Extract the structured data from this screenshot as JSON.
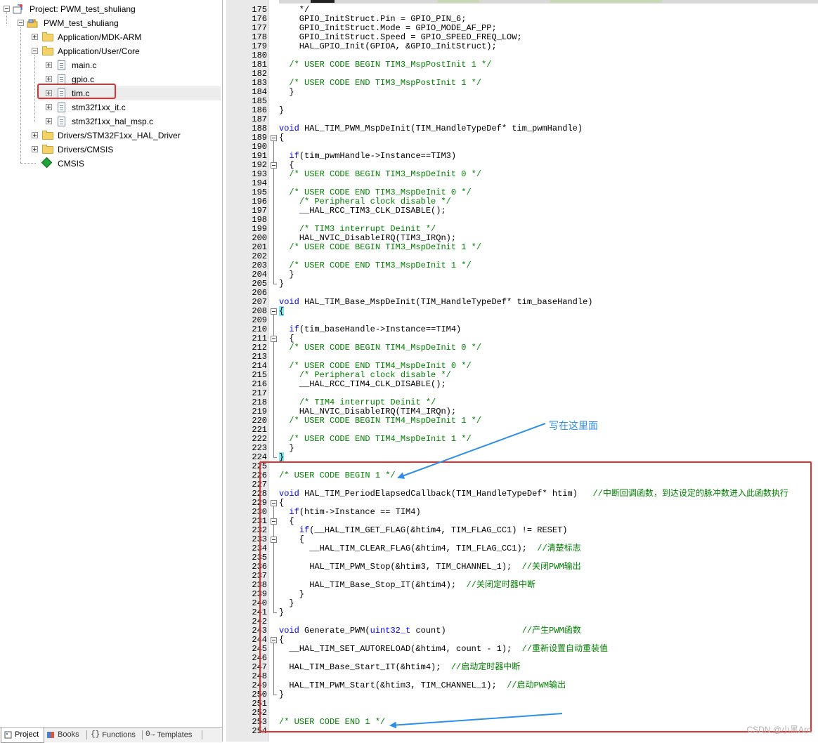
{
  "project_tree": {
    "root": "Project: PWM_test_shuliang",
    "target": "PWM_test_shuliang",
    "groups": [
      "Application/MDK-ARM",
      "Application/User/Core",
      "Drivers/STM32F1xx_HAL_Driver",
      "Drivers/CMSIS"
    ],
    "files": [
      "main.c",
      "gpio.c",
      "tim.c",
      "stm32f1xx_it.c",
      "stm32f1xx_hal_msp.c"
    ],
    "cmsis": "CMSIS",
    "selected_file": "tim.c"
  },
  "bottom_tabs": [
    "Project",
    "Books",
    "Functions",
    "Templates"
  ],
  "code_lines": [
    {
      "n": "175",
      "t": "    */"
    },
    {
      "n": "176",
      "t": "    GPIO_InitStruct.Pin = GPIO_PIN_6;"
    },
    {
      "n": "177",
      "t": "    GPIO_InitStruct.Mode = GPIO_MODE_AF_PP;"
    },
    {
      "n": "178",
      "t": "    GPIO_InitStruct.Speed = GPIO_SPEED_FREQ_LOW;"
    },
    {
      "n": "179",
      "t": "    HAL_GPIO_Init(GPIOA, &GPIO_InitStruct);"
    },
    {
      "n": "180",
      "t": ""
    },
    {
      "n": "181",
      "t": "  /* USER CODE BEGIN TIM3_MspPostInit 1 */"
    },
    {
      "n": "182",
      "t": ""
    },
    {
      "n": "183",
      "t": "  /* USER CODE END TIM3_MspPostInit 1 */"
    },
    {
      "n": "184",
      "t": "  }"
    },
    {
      "n": "185",
      "t": ""
    },
    {
      "n": "186",
      "t": "}"
    },
    {
      "n": "187",
      "t": ""
    },
    {
      "n": "188",
      "t": "void HAL_TIM_PWM_MspDeInit(TIM_HandleTypeDef* tim_pwmHandle)"
    },
    {
      "n": "189",
      "t": "{"
    },
    {
      "n": "190",
      "t": ""
    },
    {
      "n": "191",
      "t": "  if(tim_pwmHandle->Instance==TIM3)"
    },
    {
      "n": "192",
      "t": "  {"
    },
    {
      "n": "193",
      "t": "  /* USER CODE BEGIN TIM3_MspDeInit 0 */"
    },
    {
      "n": "194",
      "t": ""
    },
    {
      "n": "195",
      "t": "  /* USER CODE END TIM3_MspDeInit 0 */"
    },
    {
      "n": "196",
      "t": "    /* Peripheral clock disable */"
    },
    {
      "n": "197",
      "t": "    __HAL_RCC_TIM3_CLK_DISABLE();"
    },
    {
      "n": "198",
      "t": ""
    },
    {
      "n": "199",
      "t": "    /* TIM3 interrupt Deinit */"
    },
    {
      "n": "200",
      "t": "    HAL_NVIC_DisableIRQ(TIM3_IRQn);"
    },
    {
      "n": "201",
      "t": "  /* USER CODE BEGIN TIM3_MspDeInit 1 */"
    },
    {
      "n": "202",
      "t": ""
    },
    {
      "n": "203",
      "t": "  /* USER CODE END TIM3_MspDeInit 1 */"
    },
    {
      "n": "204",
      "t": "  }"
    },
    {
      "n": "205",
      "t": "}"
    },
    {
      "n": "206",
      "t": ""
    },
    {
      "n": "207",
      "t": "void HAL_TIM_Base_MspDeInit(TIM_HandleTypeDef* tim_baseHandle)"
    },
    {
      "n": "208",
      "t": "{"
    },
    {
      "n": "209",
      "t": ""
    },
    {
      "n": "210",
      "t": "  if(tim_baseHandle->Instance==TIM4)"
    },
    {
      "n": "211",
      "t": "  {"
    },
    {
      "n": "212",
      "t": "  /* USER CODE BEGIN TIM4_MspDeInit 0 */"
    },
    {
      "n": "213",
      "t": ""
    },
    {
      "n": "214",
      "t": "  /* USER CODE END TIM4_MspDeInit 0 */"
    },
    {
      "n": "215",
      "t": "    /* Peripheral clock disable */"
    },
    {
      "n": "216",
      "t": "    __HAL_RCC_TIM4_CLK_DISABLE();"
    },
    {
      "n": "217",
      "t": ""
    },
    {
      "n": "218",
      "t": "    /* TIM4 interrupt Deinit */"
    },
    {
      "n": "219",
      "t": "    HAL_NVIC_DisableIRQ(TIM4_IRQn);"
    },
    {
      "n": "220",
      "t": "  /* USER CODE BEGIN TIM4_MspDeInit 1 */"
    },
    {
      "n": "221",
      "t": ""
    },
    {
      "n": "222",
      "t": "  /* USER CODE END TIM4_MspDeInit 1 */"
    },
    {
      "n": "223",
      "t": "  }"
    },
    {
      "n": "224",
      "t": "}"
    },
    {
      "n": "225",
      "t": ""
    },
    {
      "n": "226",
      "t": "/* USER CODE BEGIN 1 */"
    },
    {
      "n": "227",
      "t": ""
    },
    {
      "n": "228",
      "t": "void HAL_TIM_PeriodElapsedCallback(TIM_HandleTypeDef* htim)   //中断回调函数，到达设定的脉冲数进入此函数执行"
    },
    {
      "n": "229",
      "t": "{"
    },
    {
      "n": "230",
      "t": "  if(htim->Instance == TIM4)"
    },
    {
      "n": "231",
      "t": "  {"
    },
    {
      "n": "232",
      "t": "    if(__HAL_TIM_GET_FLAG(&htim4, TIM_FLAG_CC1) != RESET)"
    },
    {
      "n": "233",
      "t": "    {"
    },
    {
      "n": "234",
      "t": "      __HAL_TIM_CLEAR_FLAG(&htim4, TIM_FLAG_CC1);  //清楚标志"
    },
    {
      "n": "235",
      "t": ""
    },
    {
      "n": "236",
      "t": "      HAL_TIM_PWM_Stop(&htim3, TIM_CHANNEL_1);  //关闭PWM输出"
    },
    {
      "n": "237",
      "t": ""
    },
    {
      "n": "238",
      "t": "      HAL_TIM_Base_Stop_IT(&htim4);  //关闭定时器中断"
    },
    {
      "n": "239",
      "t": "    }"
    },
    {
      "n": "240",
      "t": "  }"
    },
    {
      "n": "241",
      "t": "}"
    },
    {
      "n": "242",
      "t": ""
    },
    {
      "n": "243",
      "t": "void Generate_PWM(uint32_t count)               //产生PWM函数"
    },
    {
      "n": "244",
      "t": "{"
    },
    {
      "n": "245",
      "t": "  __HAL_TIM_SET_AUTORELOAD(&htim4, count - 1);  //重新设置自动重装值"
    },
    {
      "n": "246",
      "t": ""
    },
    {
      "n": "247",
      "t": "  HAL_TIM_Base_Start_IT(&htim4);  //启动定时器中断"
    },
    {
      "n": "248",
      "t": ""
    },
    {
      "n": "249",
      "t": "  HAL_TIM_PWM_Start(&htim3, TIM_CHANNEL_1);  //启动PWM输出"
    },
    {
      "n": "250",
      "t": "}"
    },
    {
      "n": "251",
      "t": ""
    },
    {
      "n": "252",
      "t": ""
    },
    {
      "n": "253",
      "t": "/* USER CODE END 1 */"
    },
    {
      "n": "254",
      "t": ""
    }
  ],
  "annotation": "写在这里面",
  "watermark": "CSDN @小黑Arc",
  "colors": {
    "comment": "#008000",
    "keyword": "#0000ff",
    "highlight_box": "#e3312d",
    "annotation_arrow": "#2f8ee8",
    "brace_match": "#7fe8f0"
  }
}
